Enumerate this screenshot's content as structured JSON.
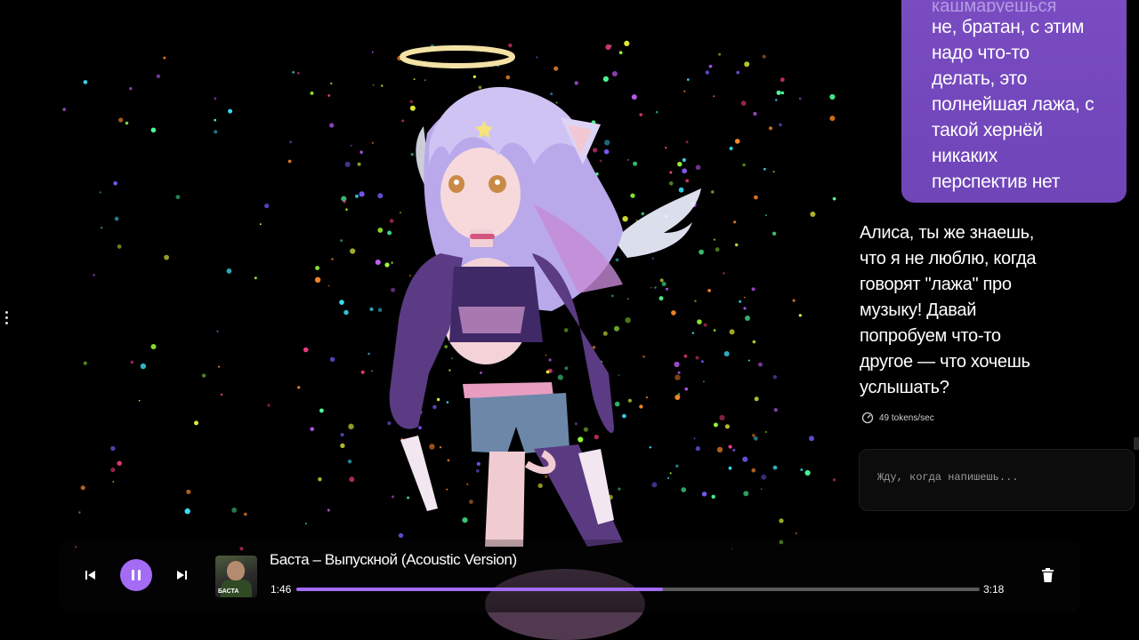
{
  "chat": {
    "user_message_cut": "кашмаруешься",
    "user_message": "не, братан, с этим\nнадо что-то\nделать, это\nполнейшая лажа, с\nтакой хернёй\nникаких\nперспектив нет",
    "assistant_message": " Алиса, ты же знаешь,\nчто я не люблю, когда\nговорят \"лажа\" про\nмузыку!  Давай\nпопробуем что-то\nдругое — что хочешь\nуслышать?",
    "speed": "49 tokens/sec",
    "input_placeholder": "Жду, когда напишешь..."
  },
  "player": {
    "track_title": "Баста – Выпускной (Acoustic Version)",
    "album_label": "БАСТА",
    "time_current": "1:46",
    "time_total": "3:18",
    "progress": 0.537,
    "accent_color": "#a46bf5"
  },
  "icons": [
    "menu-dots-icon",
    "speed-gauge-icon",
    "previous-icon",
    "pause-icon",
    "next-icon",
    "trash-icon"
  ]
}
